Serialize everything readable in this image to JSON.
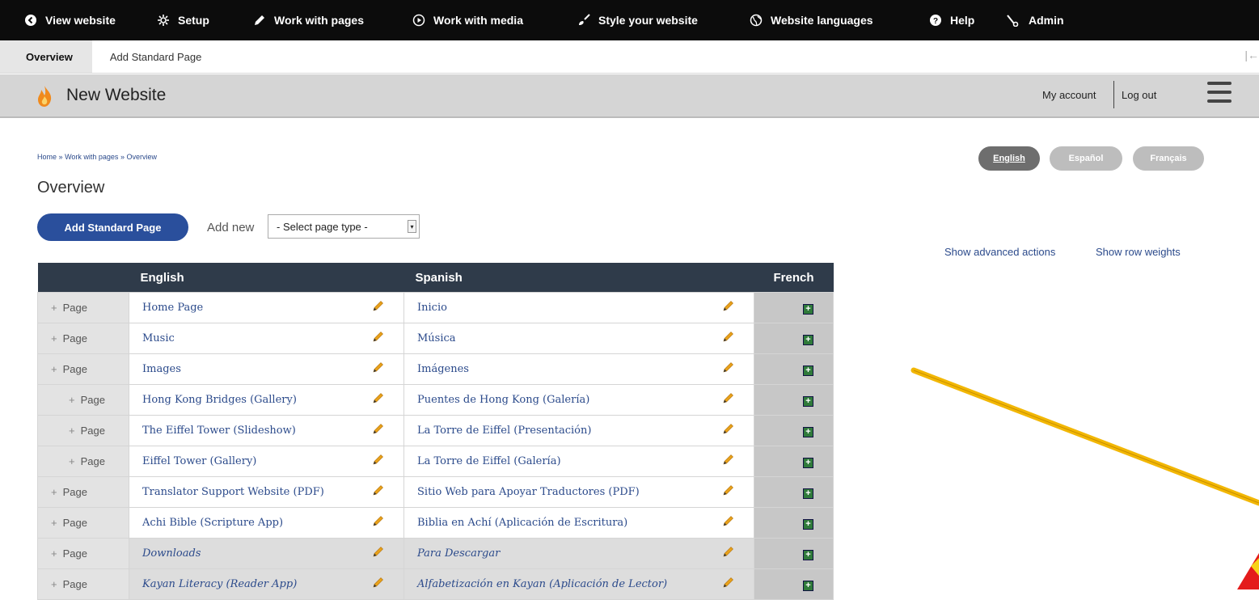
{
  "toolbar": {
    "items": [
      {
        "label": "View website",
        "icon": "chevron-left-circle-icon"
      },
      {
        "label": "Setup",
        "icon": "gear-icon"
      },
      {
        "label": "Work with pages",
        "icon": "pencil-icon"
      },
      {
        "label": "Work with media",
        "icon": "play-circle-icon"
      },
      {
        "label": "Style your website",
        "icon": "paintbrush-icon"
      },
      {
        "label": "Website languages",
        "icon": "globe-icon"
      },
      {
        "label": "Help",
        "icon": "help-circle-icon"
      },
      {
        "label": "Admin",
        "icon": "wrench-icon"
      }
    ]
  },
  "tabs": {
    "overview": "Overview",
    "add_standard_page": "Add Standard Page"
  },
  "header": {
    "site_name": "New Website",
    "my_account": "My account",
    "log_out": "Log out"
  },
  "breadcrumb": {
    "home": "Home",
    "work_with_pages": "Work with pages",
    "overview": "Overview",
    "separator": "»"
  },
  "page_title": "Overview",
  "language_switcher": [
    "English",
    "Español",
    "Français"
  ],
  "actions": {
    "add_standard_page": "Add Standard Page",
    "add_new_label": "Add new",
    "select_value": "- Select page type -",
    "show_advanced": "Show advanced actions",
    "show_weights": "Show row weights"
  },
  "table": {
    "headers": [
      "English",
      "Spanish",
      "French"
    ],
    "rows": [
      {
        "handle": "Page",
        "en": "Home Page",
        "es": "Inicio",
        "indent": false,
        "gray": false
      },
      {
        "handle": "Page",
        "en": "Music",
        "es": "Música",
        "indent": false,
        "gray": false
      },
      {
        "handle": "Page",
        "en": "Images",
        "es": "Imágenes",
        "indent": false,
        "gray": false
      },
      {
        "handle": "Page",
        "en": "Hong Kong Bridges (Gallery)",
        "es": "Puentes de Hong Kong (Galería)",
        "indent": true,
        "gray": false
      },
      {
        "handle": "Page",
        "en": "The Eiffel Tower (Slideshow)",
        "es": "La Torre de Eiffel (Presentación)",
        "indent": true,
        "gray": false
      },
      {
        "handle": "Page",
        "en": "Eiffel Tower (Gallery)",
        "es": "La Torre de Eiffel (Galería)",
        "indent": true,
        "gray": false
      },
      {
        "handle": "Page",
        "en": "Translator Support Website (PDF)",
        "es": "Sitio Web para Apoyar Traductores (PDF)",
        "indent": false,
        "gray": false
      },
      {
        "handle": "Page",
        "en": "Achi Bible (Scripture App)",
        "es": "Biblia en Achí (Aplicación de Escritura)",
        "indent": false,
        "gray": false
      },
      {
        "handle": "Page",
        "en": "Downloads",
        "es": "Para Descargar",
        "indent": false,
        "gray": true
      },
      {
        "handle": "Page",
        "en": "Kayan Literacy (Reader App)",
        "es": "Alfabetización en Kayan (Aplicación de Lector)",
        "indent": false,
        "gray": true
      }
    ]
  },
  "colors": {
    "toolbar_bg": "#0c0c0c",
    "primary_button": "#2a4f9c",
    "table_header": "#2f3b4a",
    "link": "#2b4a8b",
    "annotation_arrow": "#f2b705",
    "add_translation": "#2f7a3a"
  }
}
